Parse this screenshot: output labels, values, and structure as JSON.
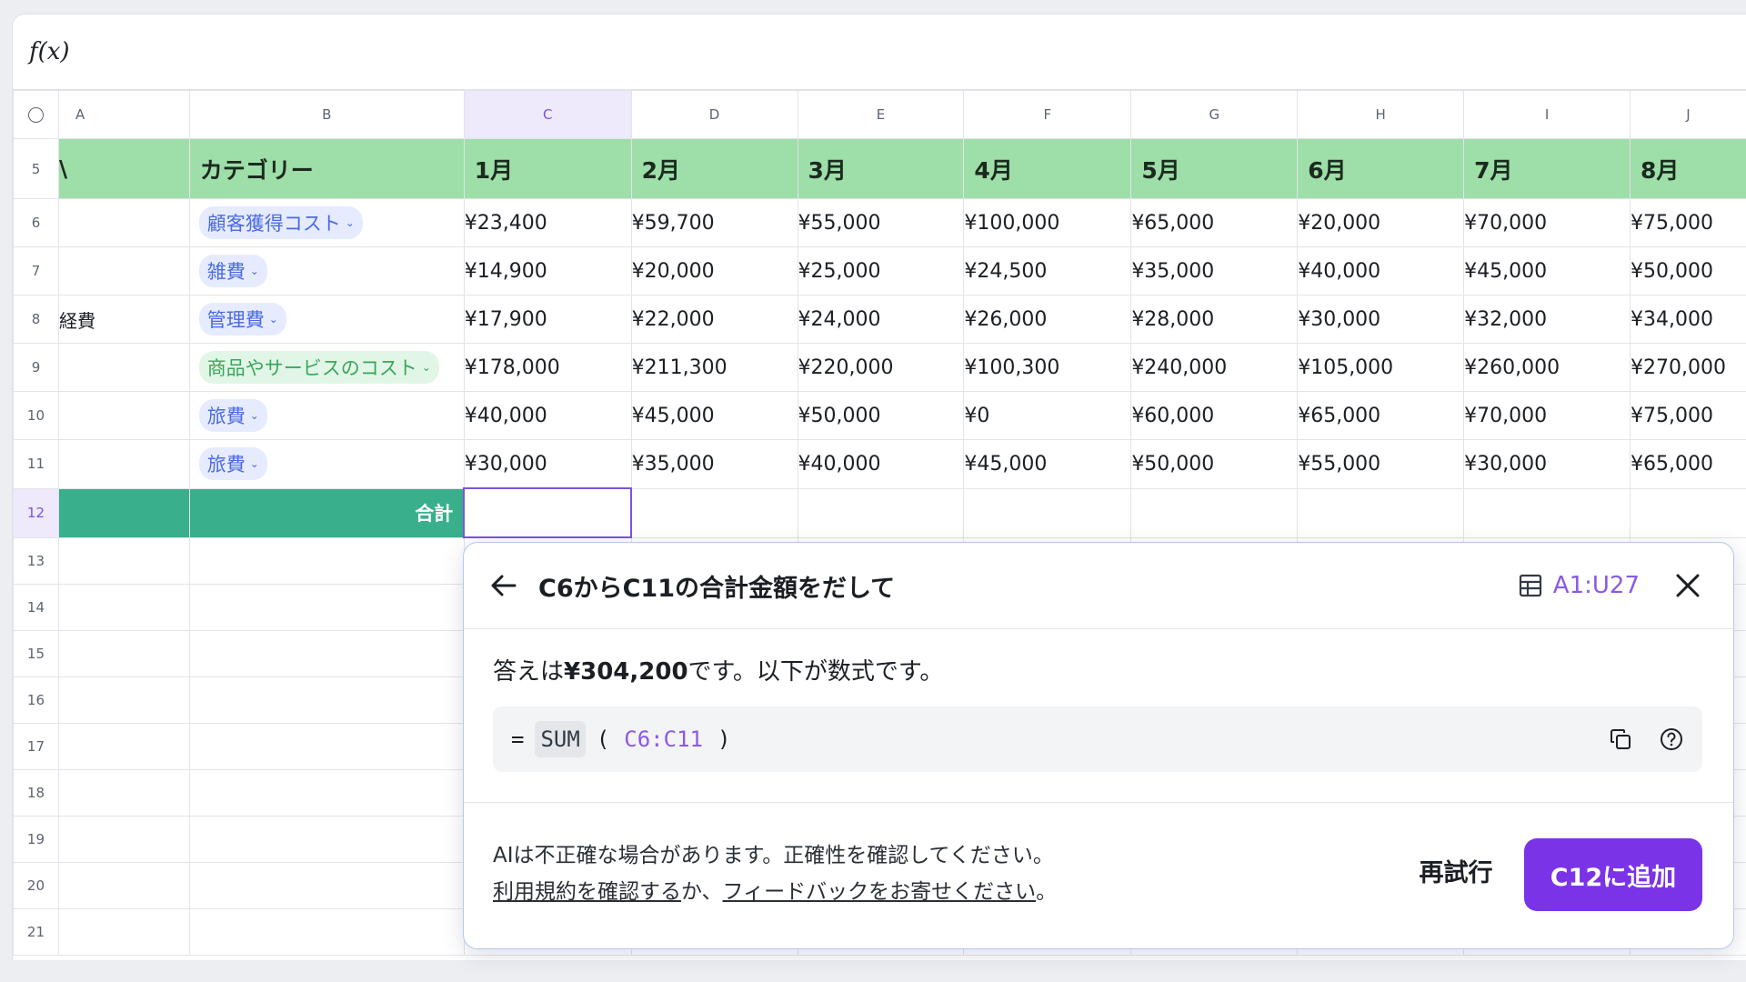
{
  "formula_bar": {
    "label": "f(x)"
  },
  "columns": [
    "A",
    "B",
    "C",
    "D",
    "E",
    "F",
    "G",
    "H",
    "I",
    "J"
  ],
  "header_row": {
    "row_number": "5",
    "a_text": "\\",
    "category": "カテゴリー",
    "months": [
      "1月",
      "2月",
      "3月",
      "4月",
      "5月",
      "6月",
      "7月",
      "8月"
    ]
  },
  "rows": [
    {
      "num": "6",
      "a": "",
      "category": "顧客獲得コスト",
      "chip": "blue",
      "values": [
        "¥23,400",
        "¥59,700",
        "¥55,000",
        "¥100,000",
        "¥65,000",
        "¥20,000",
        "¥70,000",
        "¥75,000"
      ]
    },
    {
      "num": "7",
      "a": "",
      "category": "雑費",
      "chip": "blue",
      "values": [
        "¥14,900",
        "¥20,000",
        "¥25,000",
        "¥24,500",
        "¥35,000",
        "¥40,000",
        "¥45,000",
        "¥50,000"
      ]
    },
    {
      "num": "8",
      "a": "経費",
      "category": "管理費",
      "chip": "blue",
      "values": [
        "¥17,900",
        "¥22,000",
        "¥24,000",
        "¥26,000",
        "¥28,000",
        "¥30,000",
        "¥32,000",
        "¥34,000"
      ]
    },
    {
      "num": "9",
      "a": "",
      "category": "商品やサービスのコスト",
      "chip": "green",
      "values": [
        "¥178,000",
        "¥211,300",
        "¥220,000",
        "¥100,300",
        "¥240,000",
        "¥105,000",
        "¥260,000",
        "¥270,000"
      ]
    },
    {
      "num": "10",
      "a": "",
      "category": "旅費",
      "chip": "blue",
      "values": [
        "¥40,000",
        "¥45,000",
        "¥50,000",
        "¥0",
        "¥60,000",
        "¥65,000",
        "¥70,000",
        "¥75,000"
      ]
    },
    {
      "num": "11",
      "a": "",
      "category": "旅費",
      "chip": "blue",
      "values": [
        "¥30,000",
        "¥35,000",
        "¥40,000",
        "¥45,000",
        "¥50,000",
        "¥55,000",
        "¥30,000",
        "¥65,000"
      ]
    }
  ],
  "total_row": {
    "num": "12",
    "label": "合計"
  },
  "empty_rows": [
    "13",
    "14",
    "15",
    "16",
    "17",
    "18",
    "19",
    "20",
    "21"
  ],
  "selected_column": "C",
  "selected_row": "12",
  "ai_panel": {
    "prompt": "C6からC11の合計金額をだして",
    "range": "A1:U27",
    "answer_prefix": "答えは",
    "answer_value": "¥304,200",
    "answer_suffix": "です。以下が数式です。",
    "formula": {
      "eq": "=",
      "func": "SUM",
      "open": "(",
      "ref": "C6:C11",
      "close": ")"
    },
    "disclaimer_line1": "AIは不正確な場合があります。正確性を確認してください。",
    "terms_link": "利用規約を確認する",
    "joiner": "か、",
    "feedback_link": "フィードバックをお寄せください",
    "period": "。",
    "retry_label": "再試行",
    "add_label": "C12に追加",
    "accent_color": "#7b33e8"
  }
}
